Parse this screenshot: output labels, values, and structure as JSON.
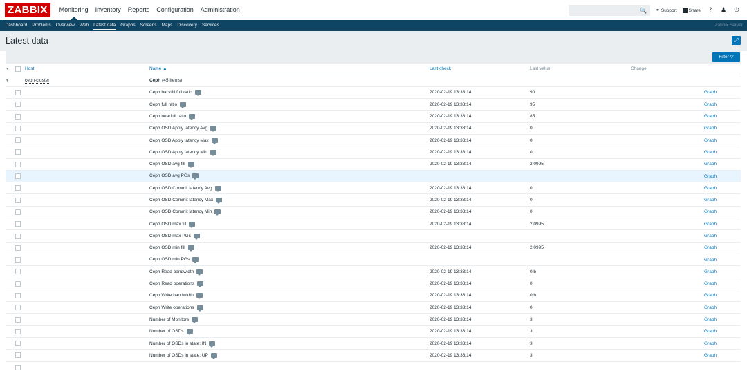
{
  "header": {
    "logo": "ZABBIX",
    "main_menu": [
      {
        "label": "Monitoring",
        "active": true
      },
      {
        "label": "Inventory",
        "active": false
      },
      {
        "label": "Reports",
        "active": false
      },
      {
        "label": "Configuration",
        "active": false
      },
      {
        "label": "Administration",
        "active": false
      }
    ],
    "search_placeholder": "",
    "support_label": "Support",
    "share_label": "Share",
    "help_icon": "?",
    "user_icon": "user-icon",
    "logout_icon": "power-icon"
  },
  "submenu": {
    "items": [
      {
        "label": "Dashboard",
        "active": false
      },
      {
        "label": "Problems",
        "active": false
      },
      {
        "label": "Overview",
        "active": false
      },
      {
        "label": "Web",
        "active": false
      },
      {
        "label": "Latest data",
        "active": true
      },
      {
        "label": "Graphs",
        "active": false
      },
      {
        "label": "Screens",
        "active": false
      },
      {
        "label": "Maps",
        "active": false
      },
      {
        "label": "Discovery",
        "active": false
      },
      {
        "label": "Services",
        "active": false
      }
    ],
    "server_name": "Zabbix Server"
  },
  "page": {
    "title": "Latest data",
    "filter_label": "Filter"
  },
  "table": {
    "columns": {
      "host": "Host",
      "name": "Name ▲",
      "last_check": "Last check",
      "last_value": "Last value",
      "change": "Change"
    },
    "host_row": {
      "host": "ceph-cluster",
      "app_name": "Ceph",
      "app_count": "(45 Items)"
    },
    "graph_label": "Graph",
    "rows": [
      {
        "name": "Ceph backfill full ratio",
        "last_check": "2020-02-19 13:33:14",
        "last_value": "90"
      },
      {
        "name": "Ceph full ratio",
        "last_check": "2020-02-19 13:33:14",
        "last_value": "95"
      },
      {
        "name": "Ceph nearfull ratio",
        "last_check": "2020-02-19 13:33:14",
        "last_value": "85"
      },
      {
        "name": "Ceph OSD Apply latency Avg",
        "last_check": "2020-02-19 13:33:14",
        "last_value": "0"
      },
      {
        "name": "Ceph OSD Apply latency Max",
        "last_check": "2020-02-19 13:33:14",
        "last_value": "0"
      },
      {
        "name": "Ceph OSD Apply latency Min",
        "last_check": "2020-02-19 13:33:14",
        "last_value": "0"
      },
      {
        "name": "Ceph OSD avg fill",
        "last_check": "2020-02-19 13:33:14",
        "last_value": "2.0995"
      },
      {
        "name": "Ceph OSD avg PGs",
        "last_check": "",
        "last_value": "",
        "highlight": true
      },
      {
        "name": "Ceph OSD Commit latency Avg",
        "last_check": "2020-02-19 13:33:14",
        "last_value": "0"
      },
      {
        "name": "Ceph OSD Commit latency Max",
        "last_check": "2020-02-19 13:33:14",
        "last_value": "0"
      },
      {
        "name": "Ceph OSD Commit latency Min",
        "last_check": "2020-02-19 13:33:14",
        "last_value": "0"
      },
      {
        "name": "Ceph OSD max fill",
        "last_check": "2020-02-19 13:33:14",
        "last_value": "2.0995"
      },
      {
        "name": "Ceph OSD max PGs",
        "last_check": "",
        "last_value": ""
      },
      {
        "name": "Ceph OSD min fill",
        "last_check": "2020-02-19 13:33:14",
        "last_value": "2.0995"
      },
      {
        "name": "Ceph OSD min PGs",
        "last_check": "",
        "last_value": ""
      },
      {
        "name": "Ceph Read bandwidth",
        "last_check": "2020-02-19 13:33:14",
        "last_value": "0 b"
      },
      {
        "name": "Ceph Read operations",
        "last_check": "2020-02-19 13:33:14",
        "last_value": "0"
      },
      {
        "name": "Ceph Write bandwidth",
        "last_check": "2020-02-19 13:33:14",
        "last_value": "0 b"
      },
      {
        "name": "Ceph Write operations",
        "last_check": "2020-02-19 13:33:14",
        "last_value": "0"
      },
      {
        "name": "Number of Monitors",
        "last_check": "2020-02-19 13:33:14",
        "last_value": "3"
      },
      {
        "name": "Number of OSDs",
        "last_check": "2020-02-19 13:33:14",
        "last_value": "3"
      },
      {
        "name": "Number of OSDs in state: IN",
        "last_check": "2020-02-19 13:33:14",
        "last_value": "3"
      },
      {
        "name": "Number of OSDs in state: UP",
        "last_check": "2020-02-19 13:33:14",
        "last_value": "3"
      }
    ]
  }
}
